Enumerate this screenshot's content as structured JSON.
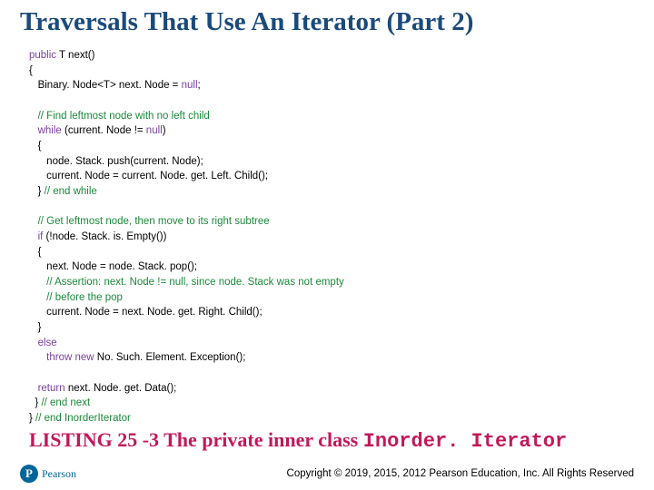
{
  "title": "Traversals That Use An Iterator (Part 2)",
  "code": {
    "l1a": "public",
    "l1b": " T next()",
    "l2": "{",
    "l3a": "   Binary. Node<T> next. Node = ",
    "l3b": "null",
    "l3c": ";",
    "l5": "   // Find leftmost node with no left child",
    "l6a": "   while",
    "l6b": " (current. Node != ",
    "l6c": "null",
    "l6d": ")",
    "l7": "   {",
    "l8": "      node. Stack. push(current. Node);",
    "l9": "      current. Node = current. Node. get. Left. Child();",
    "l10a": "   } ",
    "l10b": "// end while",
    "l12": "   // Get leftmost node, then move to its right subtree",
    "l13a": "   if",
    "l13b": " (!node. Stack. is. Empty())",
    "l14": "   {",
    "l15": "      next. Node = node. Stack. pop();",
    "l16": "      // Assertion: next. Node != null, since node. Stack was not empty",
    "l17": "      // before the pop",
    "l18": "      current. Node = next. Node. get. Right. Child();",
    "l19": "   }",
    "l20": "   else",
    "l21a": "      throw",
    "l21b": " new",
    "l21c": " No. Such. Element. Exception();",
    "l23a": "   return",
    "l23b": " next. Node. get. Data();",
    "l24a": "  } ",
    "l24b": "// end next",
    "l25a": "} ",
    "l25b": "// end InorderIterator"
  },
  "caption": {
    "prefix": "LISTING 25 -3 The private inner class ",
    "classname": "Inorder. Iterator"
  },
  "logo_letter": "P",
  "logo_text": "Pearson",
  "copyright": "Copyright © 2019, 2015, 2012 Pearson Education, Inc. All Rights Reserved"
}
